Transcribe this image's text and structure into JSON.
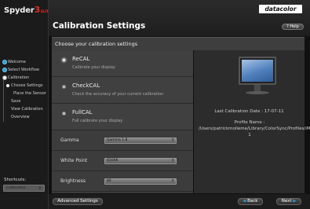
{
  "app": {
    "brand_name": "Spyder",
    "brand_number": "3",
    "brand_edition": "ELITE",
    "logo_text": "datacolor"
  },
  "header": {
    "title": "Calibration Settings",
    "help_label": "? Help"
  },
  "sidebar": {
    "items": [
      {
        "label": "Welcome",
        "state": "done"
      },
      {
        "label": "Select Workflow",
        "state": "done"
      },
      {
        "label": "Calibration",
        "state": "current"
      },
      {
        "label": "Choose Settings",
        "state": "sub-current"
      },
      {
        "label": "Place the Sensor",
        "state": "subsub"
      },
      {
        "label": "Save",
        "state": "sub"
      },
      {
        "label": "View Calibration",
        "state": "sub"
      },
      {
        "label": "Overview",
        "state": "sub"
      }
    ],
    "shortcuts_label": "Shortcuts:",
    "shortcuts_value": "Calibration"
  },
  "section": {
    "heading": "Choose your calibration settings"
  },
  "options": [
    {
      "name": "ReCAL",
      "desc": "Calibrate your display",
      "selected": true
    },
    {
      "name": "CheckCAL",
      "desc": "Check the accuracy of your current calibration",
      "selected": false
    },
    {
      "name": "FullCAL",
      "desc": "Full calibrate your display",
      "selected": false
    }
  ],
  "settings": {
    "gamma": {
      "label": "Gamma",
      "value": "Gamma 1.8"
    },
    "white_point": {
      "label": "White Point",
      "value": "6500K"
    },
    "brightness": {
      "label": "Brightness",
      "value": "80"
    }
  },
  "info": {
    "last_calibration": "Last Calibration Date : 17-07-11",
    "profile_name": "Profile Name : /Users/patrickmolleme/Library/ColorSync/Profiles/iMac-1"
  },
  "footer": {
    "advanced_label": "Advanced Settings",
    "back_label": "Back",
    "next_label": "Next"
  },
  "colors": {
    "accent": "#2aa0d8",
    "brand_red": "#e12a2a"
  },
  "icons": {
    "back": "back-arrow-icon",
    "next": "next-arrow-icon",
    "monitor": "monitor-icon"
  }
}
